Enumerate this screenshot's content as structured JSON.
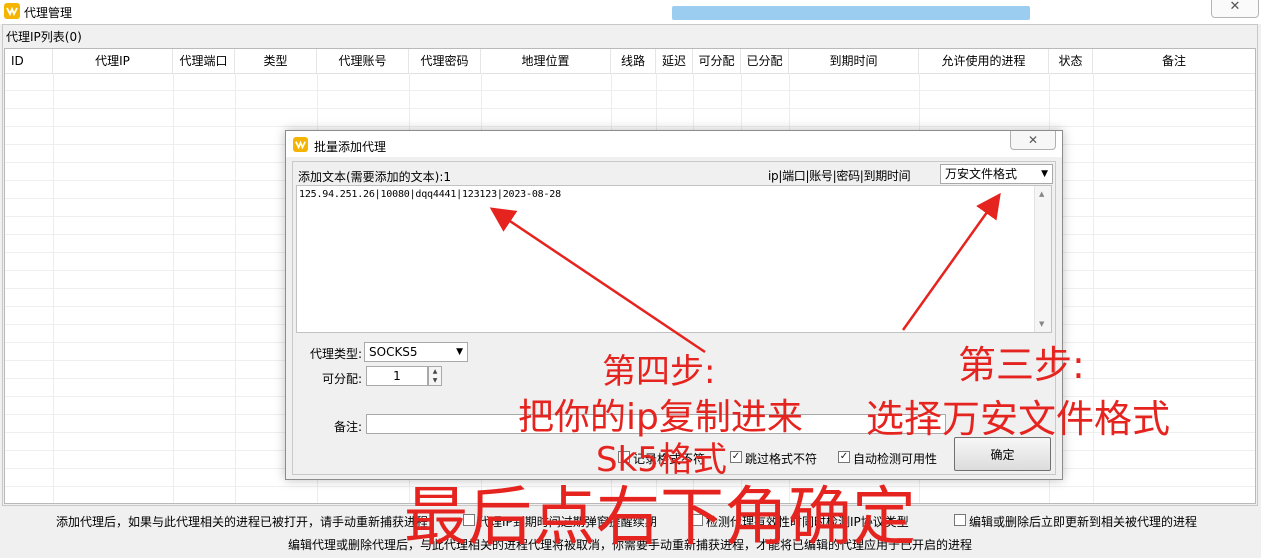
{
  "window": {
    "title": "代理管理"
  },
  "list": {
    "label": "代理IP列表(0)",
    "columns": [
      "ID",
      "代理IP",
      "代理端口",
      "类型",
      "代理账号",
      "代理密码",
      "地理位置",
      "线路",
      "延迟",
      "可分配",
      "已分配",
      "到期时间",
      "允许使用的进程",
      "状态",
      "备注"
    ],
    "rows": []
  },
  "dialog": {
    "title": "批量添加代理",
    "close_glyph": "✕",
    "add_text_label": "添加文本(需要添加的文本):1",
    "format_hint": "ip|端口|账号|密码|到期时间",
    "format_select": "万安文件格式",
    "text_content": "125.94.251.26|10080|dqq4441|123123|2023-08-28",
    "proxy_type_label": "代理类型:",
    "proxy_type_value": "SOCKS5",
    "allocatable_label": "可分配:",
    "allocatable_value": "1",
    "note_label": "备注:",
    "note_value": "",
    "check_skip_format": "跳过格式不符",
    "check_auto_check": "自动检测可用性",
    "check_partial": "记录格式不符",
    "ok_button": "确定"
  },
  "footer": {
    "line1_text": "添加代理后，如果与此代理相关的进程已被打开，请手动重新捕获进程",
    "opt_expire_remind": "代理IP到期时间过期弹窗提醒续期",
    "opt_check_valid": "检测代理有效性时同时检测IP协议类型",
    "opt_update_after_edit": "编辑或删除后立即更新到相关被代理的进程",
    "line2_text": "编辑代理或删除代理后，与此代理相关的进程代理将被取消，你需要手动重新捕获进程，才能将已编辑的代理应用于已开启的进程"
  },
  "annotations": {
    "step4_title": "第四步:",
    "step4_line1": "把你的ip复制进来",
    "step4_line2": "Sk5格式",
    "step3_title": "第三步:",
    "step3_line1": "选择万安文件格式",
    "final": "最后点右下角确定"
  },
  "colors": {
    "annotation": "#e5231f",
    "icon_yellow": "#f4b400",
    "blurred_bar": "#8ac4ee"
  }
}
